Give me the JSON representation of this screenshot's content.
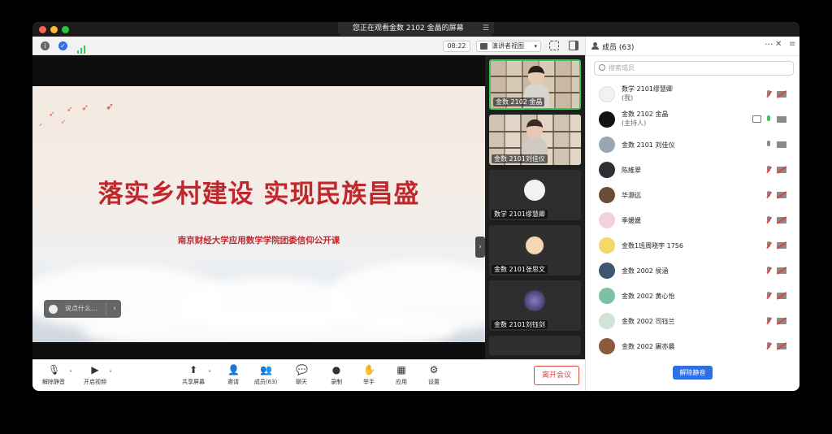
{
  "window": {
    "share_banner": "您正在观看金数 2102 金晶的屏幕"
  },
  "toolbar": {
    "time": "08:22",
    "view_mode": "演讲者视图"
  },
  "slide": {
    "title": "落实乡村建设 实现民族昌盛",
    "subtitle": "南京财经大学应用数学学院团委信仰公开课"
  },
  "chat": {
    "placeholder": "说点什么..."
  },
  "video_tiles": [
    {
      "name": "金数 2102 金晶"
    },
    {
      "name": "金数 2101刘佳仪"
    },
    {
      "name": "数学 2101缪慧卿"
    },
    {
      "name": "金数 2101张思文"
    },
    {
      "name": "金数 2101刘钰剑"
    }
  ],
  "controls": {
    "unmute": "解除静音",
    "start_video": "开启视频",
    "share_screen": "共享屏幕",
    "invite": "邀请",
    "members": "成员(63)",
    "chat": "聊天",
    "record": "录制",
    "raise_hand": "举手",
    "apps": "应用",
    "settings": "设置",
    "leave": "离开会议"
  },
  "panel": {
    "title": "成员 (63)",
    "search_placeholder": "搜索成员",
    "unmute_all": "解除静音",
    "members": [
      {
        "name": "数学 2101缪慧卿",
        "role": "(我)"
      },
      {
        "name": "金数 2102 金晶",
        "role": "(主持人)"
      },
      {
        "name": "金数 2101 刘佳仪",
        "role": ""
      },
      {
        "name": "陈維翠",
        "role": ""
      },
      {
        "name": "华灏远",
        "role": ""
      },
      {
        "name": "季媛媛",
        "role": ""
      },
      {
        "name": "金数1班周晓宇 1756",
        "role": ""
      },
      {
        "name": "金数 2002 侯涵",
        "role": ""
      },
      {
        "name": "金数 2002 黄心怡",
        "role": ""
      },
      {
        "name": "金数 2002 司钰兰",
        "role": ""
      },
      {
        "name": "金数 2002 屠亦晨",
        "role": ""
      }
    ]
  }
}
